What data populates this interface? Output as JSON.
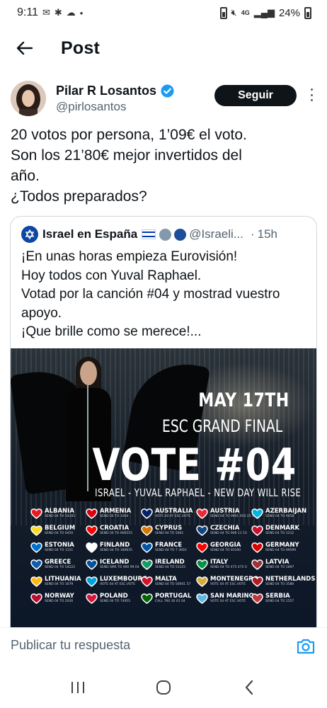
{
  "status_bar": {
    "time": "9:11",
    "network": "4G",
    "battery": "24%"
  },
  "header": {
    "title": "Post"
  },
  "author": {
    "name": "Pilar R Losantos",
    "handle": "@pirlosantos",
    "follow_label": "Seguir"
  },
  "tweet": {
    "lines": [
      "20 votos por persona, 1’09€ el voto.",
      "Son los 21’80€ mejor invertidos del",
      "año.",
      "¿Todos preparados?"
    ]
  },
  "quote": {
    "name": "Israel en España",
    "handle": "@Israeli...",
    "separator": "·",
    "time": "15h",
    "lines": [
      "¡En unas horas empieza Eurovisión!",
      "Hoy todos con Yuval Raphael.",
      "Votad por la canción #04 y mostrad vuestro",
      "apoyo.",
      "¡Que brille como se merece!..."
    ]
  },
  "poster": {
    "date": "MAY 17TH",
    "subtitle": "ESC GRAND FINAL",
    "headline": "VOTE #04",
    "line": "ISRAEL - YUVAL RAPHAEL - NEW DAY WILL RISE",
    "countries": [
      {
        "name": "ALBANIA",
        "info": "SEND 04 TO 54345",
        "color": "#e41e20"
      },
      {
        "name": "ARMENIA",
        "info": "SEND 04 TO 1004",
        "color": "#d90012"
      },
      {
        "name": "AUSTRALIA",
        "info": "VOTE 04 AT ESC.VOTE",
        "color": "#012169"
      },
      {
        "name": "AUSTRIA",
        "info": "SEND 04 TO 0901 050 25 04",
        "color": "#ed2939"
      },
      {
        "name": "AZERBAIJAN",
        "info": "SEND 04 TO 9458",
        "color": "#00b5e2"
      },
      {
        "name": "BELGIUM",
        "info": "SEND 04 TO 6450",
        "color": "#fdda24"
      },
      {
        "name": "CROATIA",
        "info": "SEND 04 TO 666555",
        "color": "#ff0000"
      },
      {
        "name": "CYPRUS",
        "info": "SEND 04 TO 5661",
        "color": "#d57800"
      },
      {
        "name": "CZECHIA",
        "info": "SEND 04 TO 906 11 53",
        "color": "#11457e"
      },
      {
        "name": "DENMARK",
        "info": "SEND 04 TO 1212",
        "color": "#c8102e"
      },
      {
        "name": "ESTONIA",
        "info": "SEND 04 TO 1311",
        "color": "#0072ce"
      },
      {
        "name": "FINLAND",
        "info": "SEND 04 TO 180635",
        "color": "#ffffff"
      },
      {
        "name": "FRANCE",
        "info": "SEND 04 TO 7 3003",
        "color": "#0055a4"
      },
      {
        "name": "GEORGIA",
        "info": "SEND 04 TO 93100",
        "color": "#ff0000"
      },
      {
        "name": "GERMANY",
        "info": "SEND 04 TO 99599",
        "color": "#dd0000"
      },
      {
        "name": "GREECE",
        "info": "SEND 04 TO 54222",
        "color": "#0d5eaf"
      },
      {
        "name": "ICELAND",
        "info": "SEND SMS TO 900 99 04",
        "color": "#02529c"
      },
      {
        "name": "IRELAND",
        "info": "SEND 04 TO 53125",
        "color": "#169b62"
      },
      {
        "name": "ITALY",
        "info": "SEND 04 TO 475 475 0",
        "color": "#009246"
      },
      {
        "name": "LATVIA",
        "info": "SEND 04 TO 1897",
        "color": "#9e3039"
      },
      {
        "name": "LITHUANIA",
        "info": "SEND 04 TO 1679",
        "color": "#fdb913"
      },
      {
        "name": "LUXEMBOURG",
        "info": "VOTE 04 AT ESC.VOTE",
        "color": "#00a1de"
      },
      {
        "name": "MALTA",
        "info": "SEND 04 TO 50041 57",
        "color": "#cf142b"
      },
      {
        "name": "MONTENEGRO",
        "info": "VOTE 04 AT ESC.VOTE",
        "color": "#d3ae3b"
      },
      {
        "name": "NETHERLANDS",
        "info": "SEND 04 TO 3580",
        "color": "#ae1c28"
      },
      {
        "name": "NORWAY",
        "info": "SEND 04 TO 2030",
        "color": "#ba0c2f"
      },
      {
        "name": "POLAND",
        "info": "SEND 04 TO 74955",
        "color": "#dc143c"
      },
      {
        "name": "PORTUGAL",
        "info": "CALL 760 30 01 04",
        "color": "#006600"
      },
      {
        "name": "SAN MARINO",
        "info": "VOTE 04 AT ESC.VOTE",
        "color": "#5eb6e4"
      },
      {
        "name": "SERBIA",
        "info": "SEND 04 TO 1557",
        "color": "#c6363c"
      }
    ]
  },
  "reply": {
    "placeholder": "Publicar tu respuesta"
  },
  "colors": {
    "accent": "#1d9bf0",
    "text": "#0f1419",
    "muted": "#536471"
  }
}
